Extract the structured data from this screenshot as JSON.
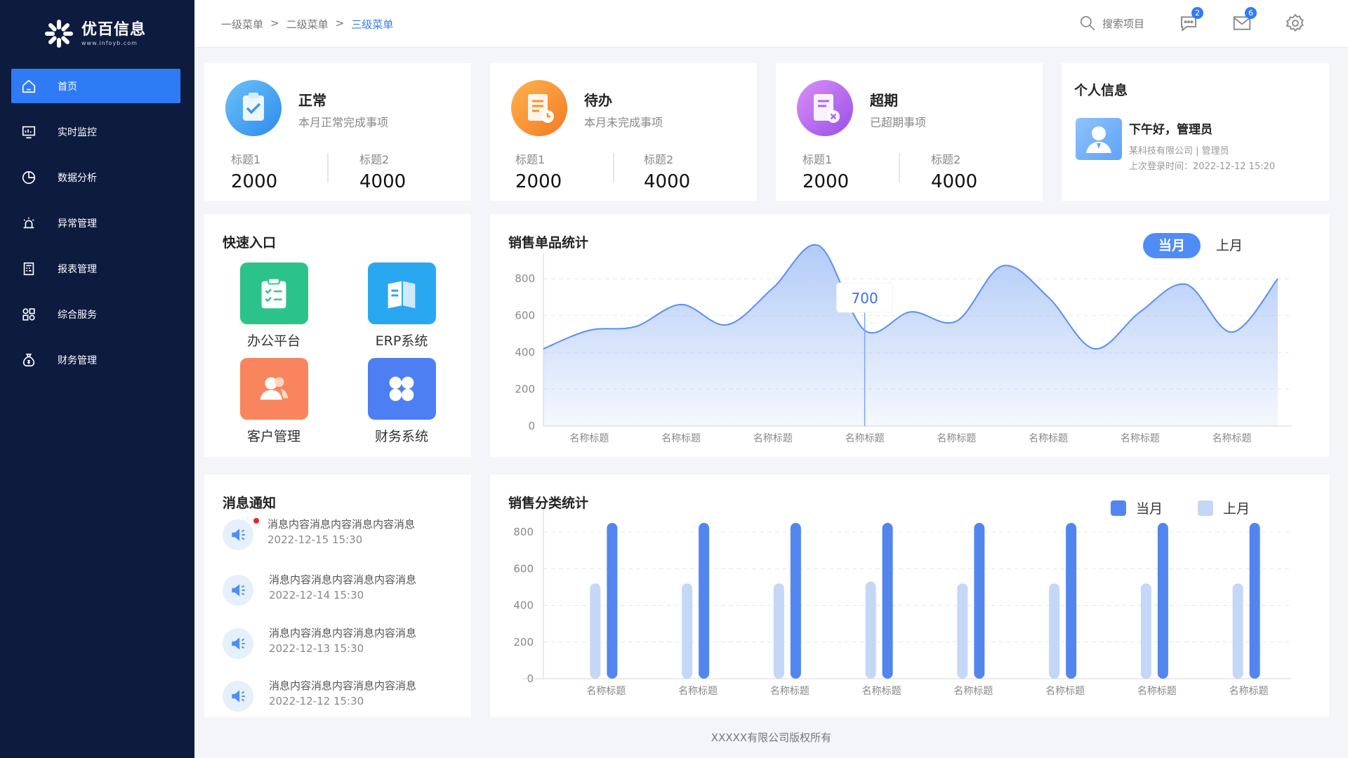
{
  "brand": {
    "name": "优百信息",
    "url": "www.infoyb.com"
  },
  "nav": [
    {
      "label": "首页",
      "icon": "home-icon",
      "active": true
    },
    {
      "label": "实时监控",
      "icon": "monitor-icon"
    },
    {
      "label": "数据分析",
      "icon": "pie-chart-icon"
    },
    {
      "label": "异常管理",
      "icon": "alarm-icon"
    },
    {
      "label": "报表管理",
      "icon": "report-icon"
    },
    {
      "label": "综合服务",
      "icon": "apps-icon"
    },
    {
      "label": "财务管理",
      "icon": "money-bag-icon"
    }
  ],
  "breadcrumb": {
    "level1": "一级菜单",
    "level2": "二级菜单",
    "level3": "三级菜单",
    "sep": ">"
  },
  "header": {
    "search_label": "搜索项目",
    "chat_badge": "2",
    "mail_badge": "6"
  },
  "stats": [
    {
      "name": "正常",
      "desc": "本月正常完成事项",
      "l1": "标题1",
      "v1": "2000",
      "l2": "标题2",
      "v2": "4000",
      "color": "#3c96ef"
    },
    {
      "name": "待办",
      "desc": "本月未完成事项",
      "l1": "标题1",
      "v1": "2000",
      "l2": "标题2",
      "v2": "4000",
      "color": "#f6922f"
    },
    {
      "name": "超期",
      "desc": "已超期事项",
      "l1": "标题1",
      "v1": "2000",
      "l2": "标题2",
      "v2": "4000",
      "color": "#b565ee"
    }
  ],
  "profile": {
    "title": "个人信息",
    "greeting": "下午好，管理员",
    "company": "某科技有限公司 | 管理员",
    "last_login": "上次登录时间：2022-12-12 15:20"
  },
  "quick": {
    "title": "快速入口",
    "items": [
      {
        "label": "办公平台",
        "color": "#2cc38a",
        "icon": "clipboard-icon"
      },
      {
        "label": "ERP系统",
        "color": "#2aa7f1",
        "icon": "book-icon"
      },
      {
        "label": "客户管理",
        "color": "#f9855e",
        "icon": "users-icon"
      },
      {
        "label": "财务系统",
        "color": "#4d7ef2",
        "icon": "grid-icon"
      }
    ]
  },
  "messages": {
    "title": "消息通知",
    "items": [
      {
        "text": "消息内容消息内容消息内容消息",
        "time": "2022-12-15  15:30",
        "unread": true
      },
      {
        "text": "消息内容消息内容消息内容消息",
        "time": "2022-12-14 15:30",
        "unread": false
      },
      {
        "text": "消息内容消息内容消息内容消息",
        "time": "2022-12-13  15:30",
        "unread": false
      },
      {
        "text": "消息内容消息内容消息内容消息",
        "time": "2022-12-12  15:30",
        "unread": false
      }
    ]
  },
  "sales_single": {
    "title": "销售单品统计",
    "toggle_on": "当月",
    "toggle_off": "上月",
    "tooltip": "700"
  },
  "sales_category": {
    "title": "销售分类统计",
    "legend_current": "当月",
    "legend_last": "上月"
  },
  "chart_data": [
    {
      "type": "area",
      "title": "销售单品统计",
      "categories": [
        "名称标题",
        "名称标题",
        "名称标题",
        "名称标题",
        "名称标题",
        "名称标题",
        "名称标题",
        "名称标题"
      ],
      "yticks": [
        0,
        200,
        400,
        600,
        800
      ],
      "ylim": [
        0,
        900
      ],
      "x": [
        0,
        0.5,
        1,
        1.5,
        2,
        2.5,
        3,
        3.5,
        4,
        4.5,
        5,
        5.5,
        6,
        6.5,
        7,
        7.5,
        8
      ],
      "values": [
        420,
        520,
        540,
        660,
        550,
        750,
        980,
        520,
        620,
        570,
        870,
        700,
        420,
        620,
        770,
        510,
        800
      ],
      "highlight": {
        "category_index": 3,
        "value": 700
      },
      "grid": true,
      "colors": {
        "line": "#5a8ff0",
        "fill": "#aec8f7"
      }
    },
    {
      "type": "bar",
      "title": "销售分类统计",
      "categories": [
        "名称标题",
        "名称标题",
        "名称标题",
        "名称标题",
        "名称标题",
        "名称标题",
        "名称标题",
        "名称标题"
      ],
      "yticks": [
        0,
        200,
        400,
        600,
        800
      ],
      "ylim": [
        0,
        900
      ],
      "series": [
        {
          "name": "上月",
          "color": "#c5d7f7",
          "values": [
            520,
            520,
            520,
            530,
            520,
            520,
            520,
            520
          ]
        },
        {
          "name": "当月",
          "color": "#5286ee",
          "values": [
            850,
            850,
            850,
            850,
            850,
            850,
            850,
            850
          ]
        }
      ],
      "legend": "top-right",
      "grid": true
    }
  ],
  "footer": "XXXXX有限公司版权所有"
}
